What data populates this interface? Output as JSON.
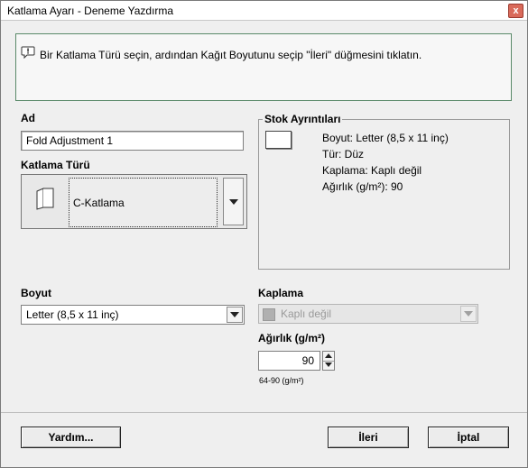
{
  "window": {
    "title": "Katlama Ayarı - Deneme Yazdırma",
    "close_label": "x"
  },
  "info": {
    "message": "Bir Katlama Türü seçin, ardından Kağıt Boyutunu seçip \"İleri\" düğmesini tıklatın."
  },
  "name": {
    "label": "Ad",
    "value": "Fold Adjustment 1"
  },
  "fold_type": {
    "label": "Katlama Türü",
    "selected": "C-Katlama"
  },
  "stock": {
    "title": "Stok Ayrıntıları",
    "size": "Boyut: Letter (8,5 x 11 inç)",
    "type": "Tür: Düz",
    "coating": "Kaplama: Kaplı değil",
    "weight": "Ağırlık (g/m²): 90"
  },
  "size": {
    "label": "Boyut",
    "selected": "Letter (8,5 x 11 inç)"
  },
  "coating": {
    "label": "Kaplama",
    "selected": "Kaplı değil"
  },
  "weight": {
    "label": "Ağırlık (g/m²)",
    "value": "90",
    "range": "64-90 (g/m²)"
  },
  "buttons": {
    "help": "Yardım...",
    "next": "İleri",
    "cancel": "İptal"
  }
}
